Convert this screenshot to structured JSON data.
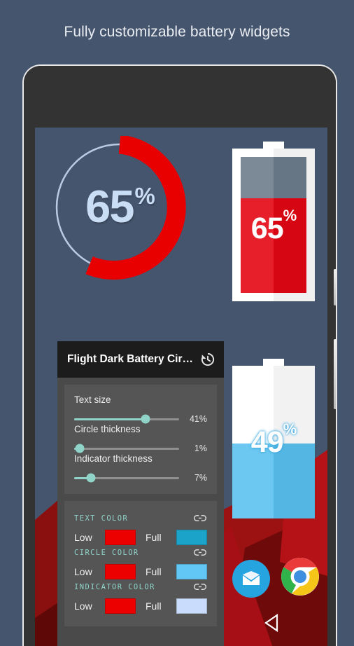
{
  "header": {
    "title": "Fully customizable battery widgets"
  },
  "colors": {
    "background": "#46556e",
    "accent_teal": "#8fd3c9",
    "red": "#e80000",
    "panel_bg": "#4a4a4a",
    "card_bg": "#555555",
    "titlebar_bg": "#1c1c1c"
  },
  "phone": {
    "camera_icon": "front-camera-icon",
    "speaker_icon": "earpiece-speaker-icon",
    "power_button": "power-button",
    "volume_button": "volume-rocker-button",
    "nav_back_icon": "back-triangle-icon"
  },
  "widgets": {
    "circle": {
      "name": "circle-battery-widget",
      "value": "65",
      "percent_symbol": "%",
      "arc_percent": 65,
      "arc_color": "#e80000",
      "ring_color": "#b9cbe4",
      "text_color": "#c9ddf4"
    },
    "battery_top": {
      "name": "battery-widget-red",
      "value": "65",
      "percent_symbol": "%",
      "fill_percent": 65,
      "fill_color": "#e30613",
      "empty_color": "#6d7d8c",
      "shell_color": "#ffffff",
      "text_color": "#ffffff"
    },
    "battery_bottom": {
      "name": "battery-widget-blue",
      "value": "49",
      "percent_symbol": "%",
      "fill_percent": 49,
      "fill_color": "#58c0ee",
      "empty_color": "#ffffff",
      "shell_color": "#ffffff",
      "text_color": "#ffffff"
    }
  },
  "panel": {
    "title": "Flight Dark Battery Cir…",
    "history_icon": "history-restore-icon",
    "sliders": [
      {
        "label": "Text size",
        "value": "41%",
        "pos": 68
      },
      {
        "label": "Circle thickness",
        "value": "1%",
        "pos": 5
      },
      {
        "label": "Indicator thickness",
        "value": "7%",
        "pos": 16
      }
    ],
    "color_sections": [
      {
        "title": "TEXT COLOR",
        "link_icon": "link-chain-icon",
        "low_label": "Low",
        "low_color": "#ec0000",
        "full_label": "Full",
        "full_color": "#1ba3c9"
      },
      {
        "title": "CIRCLE COLOR",
        "link_icon": "link-chain-icon",
        "low_label": "Low",
        "low_color": "#ec0000",
        "full_label": "Full",
        "full_color": "#62c7f5"
      },
      {
        "title": "INDICATOR COLOR",
        "link_icon": "link-chain-icon",
        "low_label": "Low",
        "low_color": "#ec0000",
        "full_label": "Full",
        "full_color": "#c9dcfb"
      }
    ]
  },
  "dock": {
    "items": [
      {
        "name": "email-app-icon",
        "label": "Email",
        "bg": "#26a4e0"
      },
      {
        "name": "chrome-app-icon",
        "label": "Chrome",
        "bg": "#ffffff"
      }
    ]
  }
}
